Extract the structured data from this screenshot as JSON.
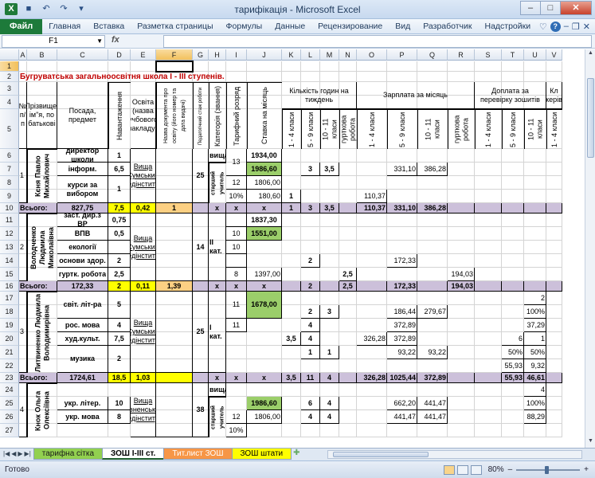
{
  "window": {
    "title": "тарифікація  -  Microsoft Excel",
    "minimize": "–",
    "maximize": "□",
    "close": "✕"
  },
  "ribbon": {
    "file": "Файл",
    "tabs": [
      "Главная",
      "Вставка",
      "Разметка страницы",
      "Формулы",
      "Данные",
      "Рецензирование",
      "Вид",
      "Разработчик",
      "Надстройки"
    ],
    "help": "?"
  },
  "formula_bar": {
    "name_box": "F1",
    "fx": "fx",
    "value": ""
  },
  "columns": [
    "A",
    "B",
    "C",
    "D",
    "E",
    "F",
    "G",
    "H",
    "I",
    "J",
    "K",
    "L",
    "M",
    "N",
    "O",
    "P",
    "Q",
    "R",
    "S",
    "T",
    "U",
    "V"
  ],
  "rows": [
    "1",
    "2",
    "3",
    "4",
    "5",
    "6",
    "7",
    "8",
    "9",
    "10",
    "11",
    "12",
    "13",
    "14",
    "15",
    "16",
    "17",
    "18",
    "19",
    "20",
    "21",
    "22",
    "23",
    "24",
    "25",
    "26",
    "27"
  ],
  "school_title": "Бугруватська загальноосвітня школа І - ІІІ ступенів.",
  "headers": {
    "num": "№ п/п",
    "name": "Прізвище, ім\"я, по батькові",
    "position": "Посада, предмет",
    "load": "Навантаження",
    "education": "Освіта (назва учбового закладу)",
    "diploma": "Назва документа про освіту (його номер та дата видачі)",
    "experience": "Педагогічний стаж роботи",
    "category": "Категорія (звання)",
    "rank": "Тарифний розряд",
    "rate": "Ставка на місяць",
    "hours_group": "Кількість годин на тиждень",
    "salary_group": "Зарплата за місяць",
    "check_group": "Доплата за перевірку зошитів",
    "last_group": "Кл керів",
    "g1": "1 - 4 класи",
    "g2": "5 - 9 класи",
    "g3": "10 - 11 класи",
    "g4": "гурткова робота"
  },
  "teachers": [
    {
      "num": "1",
      "name": "Кєня Павло Михайлович",
      "positions": [
        "директор школи",
        "інформ.",
        "курси за вибором"
      ],
      "loads": [
        "1",
        "6,5",
        "1"
      ],
      "education": "Вища Сумський педінститут",
      "experience": "25",
      "category": "вища",
      "category2": "старший учитель",
      "ranks": [
        "13",
        "12",
        "10%"
      ],
      "rates": [
        "1934,00",
        "1986,60",
        "1806,00",
        "180,60"
      ],
      "r9_k": "1",
      "r7_l": "3",
      "r7_m": "3,5",
      "r9_o": "110,37",
      "r7_p": "331,10",
      "r7_q": "386,28"
    },
    {
      "num": "2",
      "name": "Володченко Людмила Миколаївна",
      "positions": [
        "заст. дир.з ВР",
        "ВПВ",
        "екології",
        "основи здор.",
        "гуртк. робота"
      ],
      "loads": [
        "0,75",
        "0,5",
        "",
        "2",
        "2,5"
      ],
      "education": "Вища Сумський педінститут",
      "experience": "14",
      "category": "II кат.",
      "ranks": [
        "",
        "10",
        "10",
        "",
        "8"
      ],
      "rates": [
        "1837,30",
        "1551,00",
        "",
        "",
        "1397,00"
      ],
      "r14_l": "2",
      "r15_n": "2,5",
      "r14_p": "172,33",
      "r15_r": "194,03"
    },
    {
      "num": "3",
      "name": "Литвиненко Людмила Володимирівна",
      "positions": [
        "світ. літ-ра",
        "рос. мова",
        "худ.культ.",
        "музика"
      ],
      "loads": [
        "5",
        "4",
        "7,5",
        "2"
      ],
      "education": "Вища Сумський педінститут",
      "experience": "25",
      "category": "I кат.",
      "ranks": [
        "11",
        "11"
      ],
      "rates": [
        "1678,00"
      ],
      "r17_u": "2",
      "r18_l": "2",
      "r18_m": "3",
      "r18_p": "186,44",
      "r18_q": "279,67",
      "r18_u": "100%",
      "r19_l": "4",
      "r19_p": "372,89",
      "r19_u": "37,29",
      "r20_k": "3,5",
      "r20_l": "4",
      "r20_o": "326,28",
      "r20_p": "372,89",
      "r20_t": "6",
      "r20_u": "1",
      "r21_l": "1",
      "r21_m": "1",
      "r21_p": "93,22",
      "r21_q": "93,22",
      "r21_t": "50%",
      "r21_u": "50%",
      "r22_t": "55,93",
      "r22_u": "9,32"
    },
    {
      "num": "4",
      "name": "Кнок Ольга Олексіївна",
      "positions": [
        "укр. літер.",
        "укр. мова"
      ],
      "loads": [
        "10",
        "8"
      ],
      "education": "Вища Рівненський педінститут",
      "experience": "38",
      "category": "вища",
      "category2": "старший учитель",
      "ranks": [
        "",
        "12",
        "10%"
      ],
      "rates": [
        "1986,60",
        "1806,00"
      ],
      "r25_l": "6",
      "r25_m": "4",
      "r25_p": "662,20",
      "r25_q": "441,47",
      "r25_u": "100%",
      "r24_u": "4",
      "r26_l": "4",
      "r26_m": "4",
      "r26_p": "441,47",
      "r26_q": "441,47",
      "r26_u": "88,29"
    }
  ],
  "summaries": [
    {
      "label": "Всього:",
      "c": "827,75",
      "d": "7,5",
      "e": "0,42",
      "f": "1",
      "h": "x",
      "i": "x",
      "j": "x",
      "k": "1",
      "l": "3",
      "m": "3,5",
      "o": "110,37",
      "p": "331,10",
      "q": "386,28"
    },
    {
      "label": "Всього:",
      "c": "172,33",
      "d": "2",
      "e": "0,11",
      "f": "1,39",
      "h": "x",
      "i": "x",
      "j": "x",
      "l": "2",
      "n": "2,5",
      "p": "172,33",
      "r": "194,03"
    },
    {
      "label": "Всього:",
      "c": "1724,61",
      "d": "18,5",
      "e": "1,03",
      "f": "",
      "h": "x",
      "i": "x",
      "j": "x",
      "k": "3,5",
      "l": "11",
      "m": "4",
      "o": "326,28",
      "p": "1025,44",
      "q": "372,89",
      "t": "55,93",
      "u": "46,61"
    }
  ],
  "sheets": [
    "тарифна сітка",
    "ЗОШ І-ІІІ ст.",
    "Тит.лист ЗОШ",
    "ЗОШ штати"
  ],
  "status": {
    "ready": "Готово",
    "zoom": "80%",
    "minus": "–",
    "plus": "+"
  },
  "colors": {
    "summary": "#ccc0da",
    "yellow": "#ffff00",
    "orange": "#fcd083",
    "green": "#9bce6a",
    "title_red": "#c00000",
    "file_tab": "#1d7a3a"
  }
}
